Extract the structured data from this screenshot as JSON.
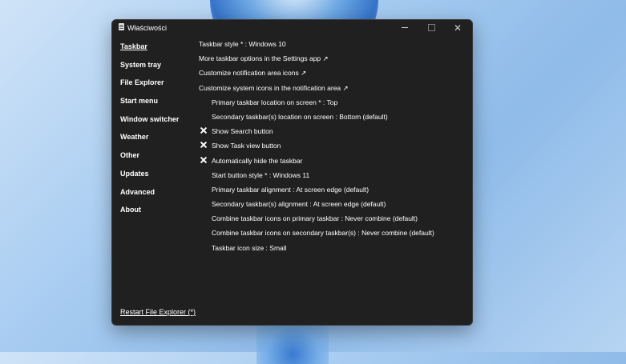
{
  "window": {
    "title": "Właściwości",
    "controls": {
      "minimize": "minimize",
      "maximize": "maximize",
      "close": "✕"
    }
  },
  "sidebar": {
    "items": [
      {
        "label": "Taskbar",
        "active": true
      },
      {
        "label": "System tray"
      },
      {
        "label": "File Explorer"
      },
      {
        "label": "Start menu"
      },
      {
        "label": "Window switcher"
      },
      {
        "label": "Weather"
      },
      {
        "label": "Other"
      },
      {
        "label": "Updates"
      },
      {
        "label": "Advanced"
      },
      {
        "label": "About"
      }
    ],
    "restart_label": "Restart File Explorer (*)"
  },
  "settings": [
    {
      "label": "Taskbar style * : Windows 10"
    },
    {
      "label": "More taskbar options in the Settings app ↗"
    },
    {
      "label": "Customize notification area icons ↗"
    },
    {
      "label": "Customize system icons in the notification area ↗"
    },
    {
      "label": "Primary taskbar location on screen * : Top"
    },
    {
      "label": "Secondary taskbar(s) location on screen : Bottom (default)"
    },
    {
      "label": "Show Search button",
      "icon": "x-icon"
    },
    {
      "label": "Show Task view button",
      "icon": "x-icon"
    },
    {
      "label": "Automatically hide the taskbar",
      "icon": "x-icon"
    },
    {
      "label": "Start button style * : Windows 11"
    },
    {
      "label": "Primary taskbar alignment : At screen edge (default)"
    },
    {
      "label": "Secondary taskbar(s) alignment : At screen edge (default)"
    },
    {
      "label": "Combine taskbar icons on primary taskbar : Never combine (default)"
    },
    {
      "label": "Combine taskbar icons on secondary taskbar(s) : Never combine (default)"
    },
    {
      "label": "Taskbar icon size : Small"
    }
  ]
}
